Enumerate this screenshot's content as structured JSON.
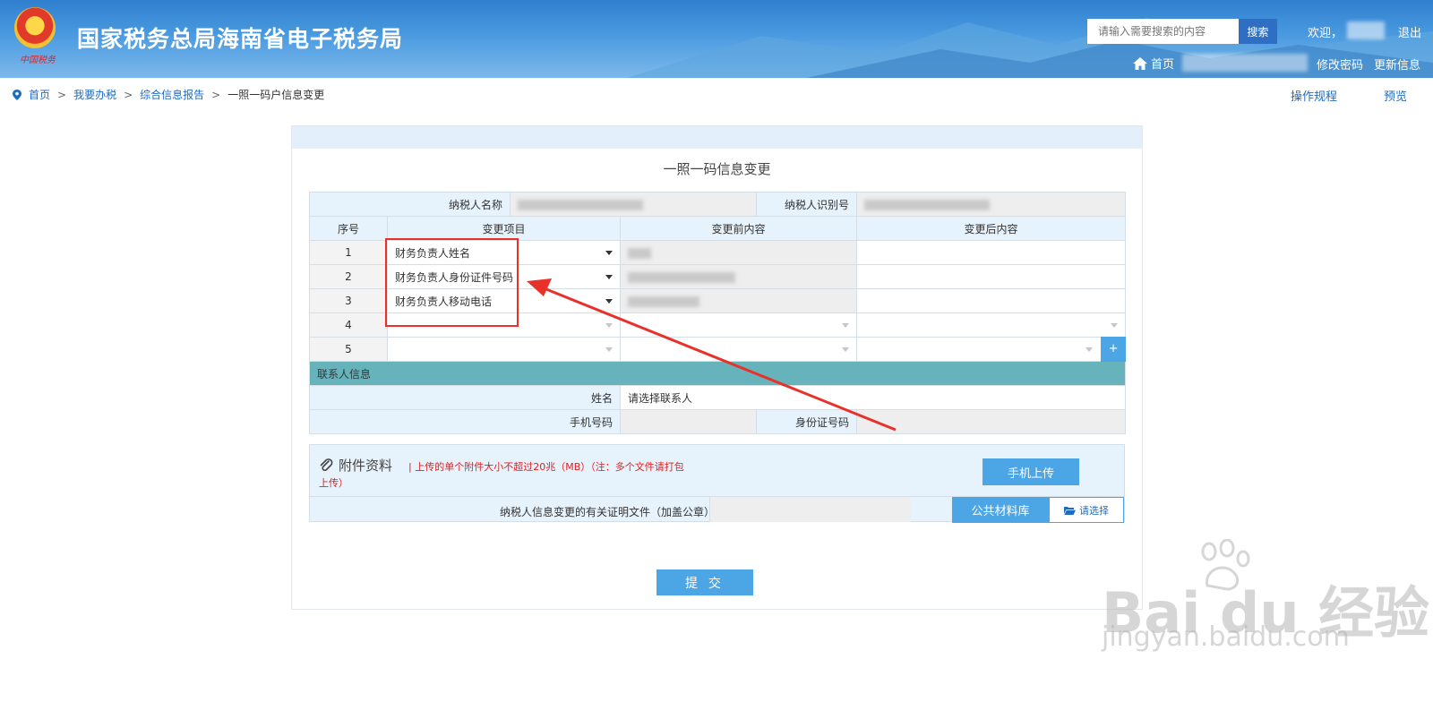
{
  "header": {
    "site_title": "国家税务总局海南省电子税务局",
    "emblem_text": "中国税务",
    "search_placeholder": "请输入需要搜索的内容",
    "search_button": "搜索",
    "welcome": "欢迎，",
    "logout": "退出",
    "home": "首页",
    "change_password": "修改密码",
    "update_info": "更新信息"
  },
  "breadcrumb": {
    "items": [
      "首页",
      "我要办税",
      "综合信息报告",
      "一照一码户信息变更"
    ],
    "separator": ">"
  },
  "top_links": {
    "procedure": "操作规程",
    "preview": "预览"
  },
  "form": {
    "title": "一照一码信息变更",
    "taxpayer_name_label": "纳税人名称",
    "taxpayer_id_label": "纳税人识别号",
    "columns": {
      "seq": "序号",
      "item": "变更项目",
      "before": "变更前内容",
      "after": "变更后内容"
    },
    "rows": [
      {
        "seq": "1",
        "item": "财务负责人姓名"
      },
      {
        "seq": "2",
        "item": "财务负责人身份证件号码"
      },
      {
        "seq": "3",
        "item": "财务负责人移动电话"
      },
      {
        "seq": "4",
        "item": ""
      },
      {
        "seq": "5",
        "item": ""
      }
    ],
    "add_row": "+",
    "contact_section": "联系人信息",
    "contact_name_label": "姓名",
    "contact_name_value": "请选择联系人",
    "phone_label": "手机号码",
    "id_label": "身份证号码"
  },
  "attachments": {
    "title": "附件资料",
    "note_line1": "| 上传的单个附件大小不超过20兆（MB）（注：多个文件请打包",
    "note_line2": "上传）",
    "mobile_upload": "手机上传",
    "doc_label": "纳税人信息变更的有关证明文件（加盖公章）",
    "public_library": "公共材料库",
    "choose": "请选择"
  },
  "submit": "提 交",
  "watermark": {
    "brand": "Bai du 经验",
    "url": "jingyan.baidu.com"
  },
  "colors": {
    "accent": "#4ca6e6",
    "header": "#3a8ad6",
    "section": "#66b3bb",
    "annotation": "#e8312a"
  }
}
